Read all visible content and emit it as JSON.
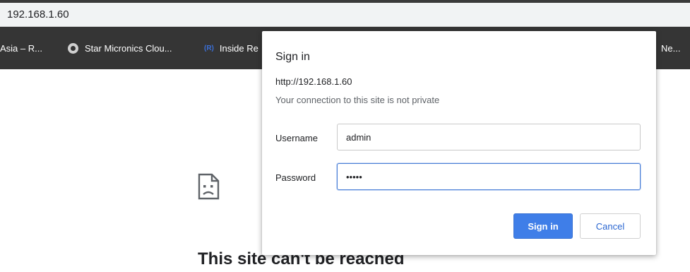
{
  "browser": {
    "url": "192.168.1.60",
    "bookmarks": [
      {
        "label": "Asia – R...",
        "icon": "none"
      },
      {
        "label": "Star Micronics Clou...",
        "icon": "globe-icon"
      },
      {
        "label": "Inside Re",
        "icon": "inside-real-estate-logo-icon",
        "logo_text": "(R)"
      },
      {
        "label": "Ne...",
        "icon": "none"
      }
    ]
  },
  "page": {
    "error_icon": "sad-document-icon",
    "error_title": "This site can't be reached"
  },
  "dialog": {
    "title": "Sign in",
    "origin": "http://192.168.1.60",
    "warning": "Your connection to this site is not private",
    "username_label": "Username",
    "username_value": "admin",
    "password_label": "Password",
    "password_value": "•••••",
    "signin_label": "Sign in",
    "cancel_label": "Cancel"
  },
  "colors": {
    "accent": "#3f7ee8",
    "bookmark_bar": "#353535"
  }
}
